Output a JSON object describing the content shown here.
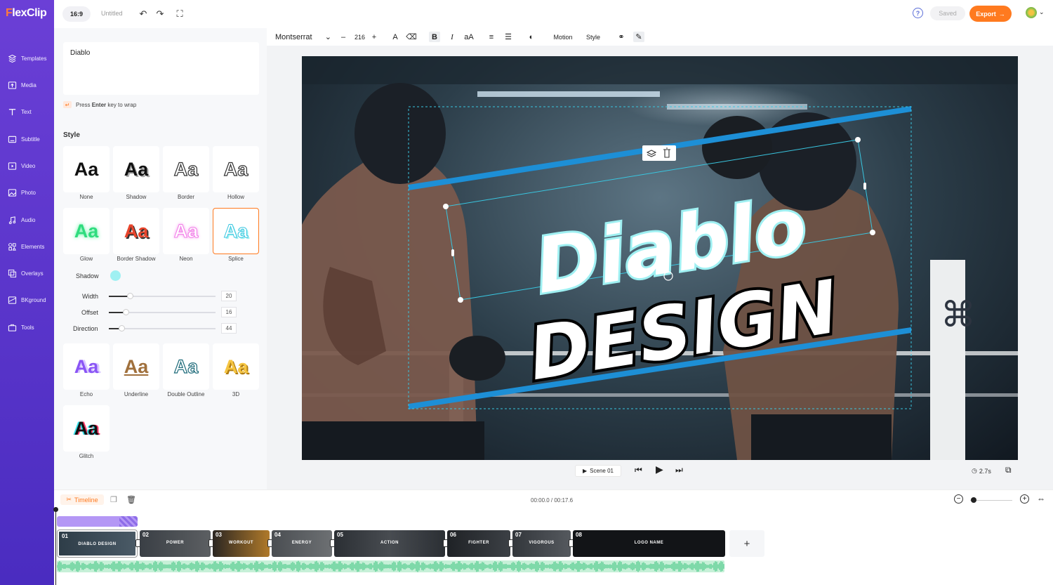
{
  "app": {
    "logo_f": "F",
    "logo_rest": "lexClip",
    "ratio": "16:9",
    "project_title": "Untitled",
    "saved": "Saved",
    "export": "Export",
    "help": "?"
  },
  "sidebar": {
    "items": [
      {
        "label": "Templates",
        "icon": "templates-icon"
      },
      {
        "label": "Media",
        "icon": "media-icon"
      },
      {
        "label": "Text",
        "icon": "text-icon"
      },
      {
        "label": "Subtitle",
        "icon": "subtitle-icon"
      },
      {
        "label": "Video",
        "icon": "video-icon"
      },
      {
        "label": "Photo",
        "icon": "photo-icon"
      },
      {
        "label": "Audio",
        "icon": "audio-icon"
      },
      {
        "label": "Elements",
        "icon": "elements-icon"
      },
      {
        "label": "Overlays",
        "icon": "overlays-icon"
      },
      {
        "label": "BKground",
        "icon": "background-icon"
      },
      {
        "label": "Tools",
        "icon": "tools-icon"
      }
    ]
  },
  "panel": {
    "text_value": "Diablo",
    "hint_pre": "Press",
    "hint_key": "Enter",
    "hint_post": "key to wrap",
    "style_heading": "Style",
    "styles": [
      "None",
      "Shadow",
      "Border",
      "Hollow",
      "Glow",
      "Border Shadow",
      "Neon",
      "Splice",
      "Echo",
      "Underline",
      "Double Outline",
      "3D",
      "Glitch"
    ],
    "style_sample": "Aa",
    "shadow_label": "Shadow",
    "shadow_color": "#9ff0f2",
    "controls": [
      {
        "label": "Width",
        "value": "20",
        "fraction": 0.2
      },
      {
        "label": "Offset",
        "value": "16",
        "fraction": 0.16
      },
      {
        "label": "Direction",
        "value": "44",
        "fraction": 0.12
      }
    ]
  },
  "format_bar": {
    "font": "Montserrat",
    "size": "216",
    "motion": "Motion",
    "style": "Style"
  },
  "canvas": {
    "line1": "Diablo",
    "line2": "DESIGN"
  },
  "player": {
    "scene": "Scene 01",
    "duration": "2.7s"
  },
  "timeline": {
    "tab": "Timeline",
    "time": "00:00.0 / 00:17.6",
    "clips": [
      {
        "num": "01",
        "label": "DIABLO DESIGN"
      },
      {
        "num": "02",
        "label": "POWER"
      },
      {
        "num": "03",
        "label": "WORKOUT"
      },
      {
        "num": "04",
        "label": "ENERGY"
      },
      {
        "num": "05",
        "label": "ACTION"
      },
      {
        "num": "06",
        "label": "FIGHTER"
      },
      {
        "num": "07",
        "label": "VIGOROUS"
      },
      {
        "num": "08",
        "label": "LOGO NAME"
      }
    ]
  },
  "colors": {
    "brand": "#5a33cc",
    "accent": "#ff7a1f",
    "selection": "#39c6e0",
    "stripe": "#1d8fd6"
  }
}
